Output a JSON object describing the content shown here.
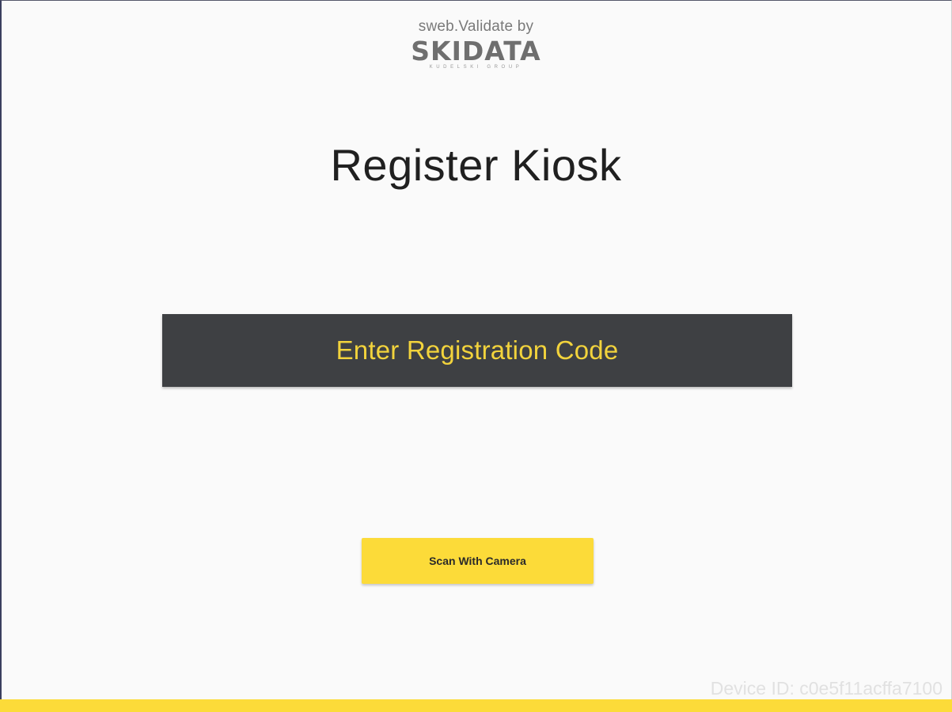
{
  "brand": {
    "caption": "sweb.Validate by",
    "name": "SKIDATA",
    "subtitle": "KUDELSKI GROUP"
  },
  "page": {
    "title": "Register Kiosk"
  },
  "actions": {
    "enter_code_label": "Enter Registration Code",
    "scan_label": "Scan With Camera"
  },
  "footer": {
    "device_id": "Device ID: c0e5f11acffa7100"
  },
  "colors": {
    "accent_yellow": "#fcdb39",
    "button_dark": "#3e4043",
    "button_text_yellow": "#f2d33c",
    "background": "#fafafa"
  }
}
